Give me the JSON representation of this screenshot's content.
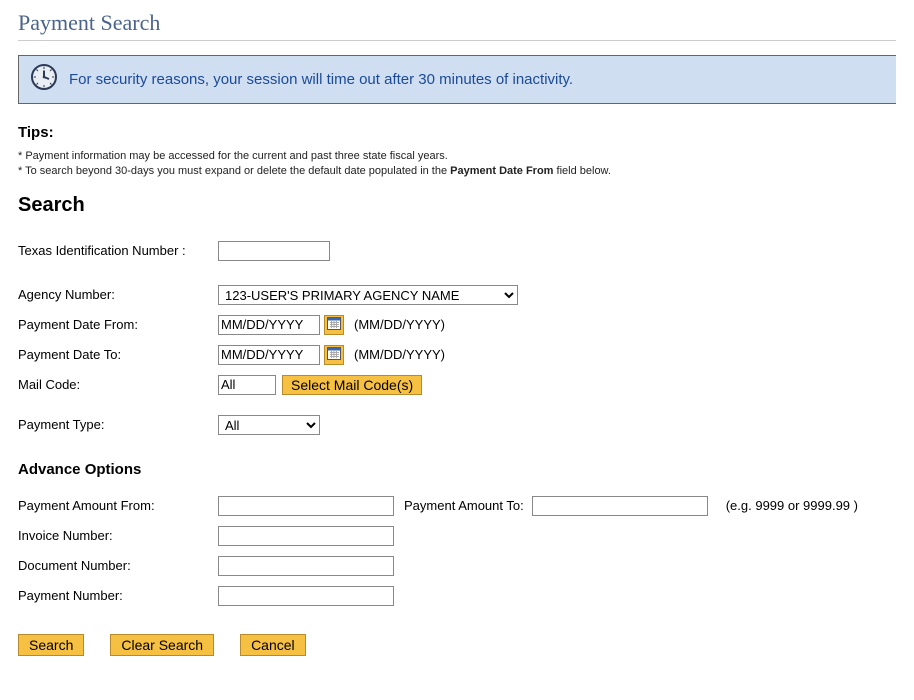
{
  "page": {
    "title": "Payment Search"
  },
  "notice": {
    "text": "For security reasons, your session will time out after 30 minutes of inactivity."
  },
  "tips": {
    "heading": "Tips:",
    "line1": "* Payment information may be accessed for the current and past three state fiscal years.",
    "line2_a": "* To search beyond 30-days you must expand or delete the default date populated in the ",
    "line2_bold": "Payment Date From",
    "line2_b": " field below."
  },
  "search": {
    "heading": "Search",
    "tin_label": "Texas Identification Number :",
    "tin_value": "",
    "agency_label": "Agency Number:",
    "agency_value": "123-USER'S PRIMARY AGENCY NAME",
    "date_from_label": "Payment Date From:",
    "date_from_placeholder": "MM/DD/YYYY",
    "date_from_hint": "(MM/DD/YYYY)",
    "date_to_label": "Payment Date To:",
    "date_to_placeholder": "MM/DD/YYYY",
    "date_to_hint": "(MM/DD/YYYY)",
    "mail_label": "Mail Code:",
    "mail_value": "All",
    "mail_button": "Select Mail Code(s)",
    "ptype_label": "Payment Type:",
    "ptype_value": "All"
  },
  "advanced": {
    "heading": "Advance Options",
    "amt_from_label": "Payment Amount From:",
    "amt_to_label": "Payment Amount To:",
    "amt_hint": "(e.g. 9999 or 9999.99 )",
    "invoice_label": "Invoice Number:",
    "document_label": "Document Number:",
    "payment_num_label": "Payment Number:"
  },
  "buttons": {
    "search": "Search",
    "clear": "Clear Search",
    "cancel": "Cancel"
  }
}
